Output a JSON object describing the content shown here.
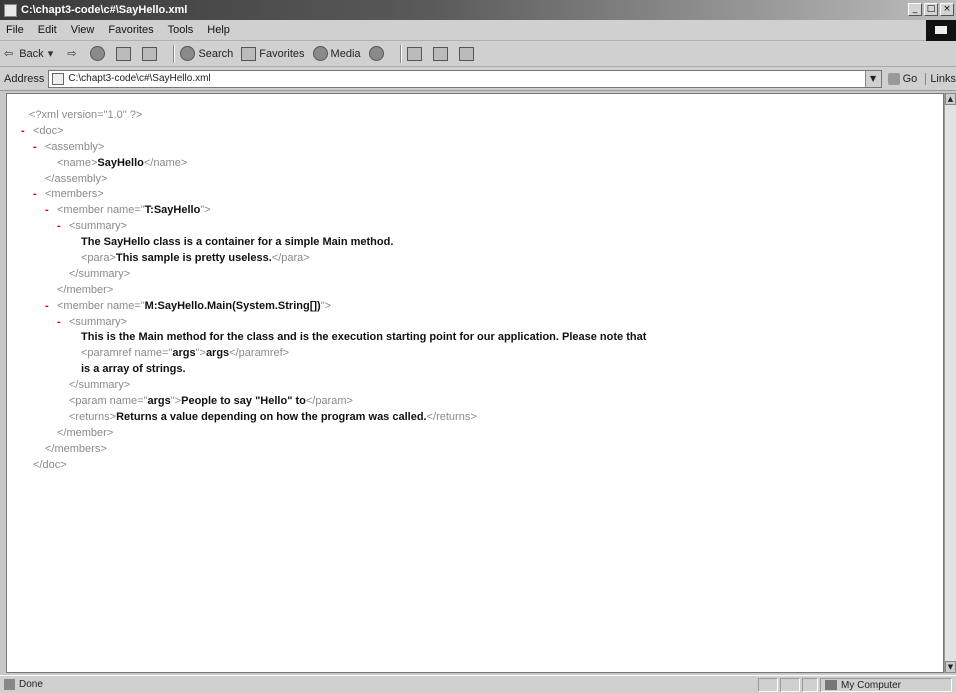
{
  "window": {
    "title": "C:\\chapt3-code\\c#\\SayHello.xml"
  },
  "menu": [
    "File",
    "Edit",
    "View",
    "Favorites",
    "Tools",
    "Help"
  ],
  "toolbar": {
    "back": "Back",
    "search": "Search",
    "favorites": "Favorites",
    "media": "Media"
  },
  "address": {
    "label": "Address",
    "url": "C:\\chapt3-code\\c#\\SayHello.xml",
    "go": "Go",
    "links": "Links"
  },
  "xml": {
    "decl": "<?xml version=\"1.0\" ?>",
    "doc_open": "<doc>",
    "assembly_open": "<assembly>",
    "name_open": "<name>",
    "name_value": "SayHello",
    "name_close": "</name>",
    "assembly_close": "</assembly>",
    "members_open": "<members>",
    "member1_open_start": "<member name=\"",
    "member1_name": "T:SayHello",
    "member_open_end": "\">",
    "summary_open": "<summary>",
    "summary1_text": "The SayHello class is a container for a simple Main method.",
    "para_open": "<para>",
    "para_text": "This sample is pretty useless.",
    "para_close": "</para>",
    "summary_close": "</summary>",
    "member_close": "</member>",
    "member2_open_start": "<member name=\"",
    "member2_name": "M:SayHello.Main(System.String[])",
    "summary2_text": "This is the Main method for the class and is the execution starting point for our application. Please note that",
    "paramref_open_start": "<paramref name=\"",
    "paramref_name": "args",
    "paramref_open_end": "\">",
    "paramref_text": "args",
    "paramref_close": "</paramref>",
    "summary2_tail": "is a array of strings.",
    "param_open_start": "<param name=\"",
    "param_name": "args",
    "param_open_end": "\">",
    "param_text": "People to say \"Hello\" to",
    "param_close": "</param>",
    "returns_open": "<returns>",
    "returns_text": "Returns a value depending on how the program was called.",
    "returns_close": "</returns>",
    "members_close": "</members>",
    "doc_close": "</doc>",
    "minus": "-"
  },
  "status": {
    "text": "Done",
    "zone": "My Computer"
  }
}
